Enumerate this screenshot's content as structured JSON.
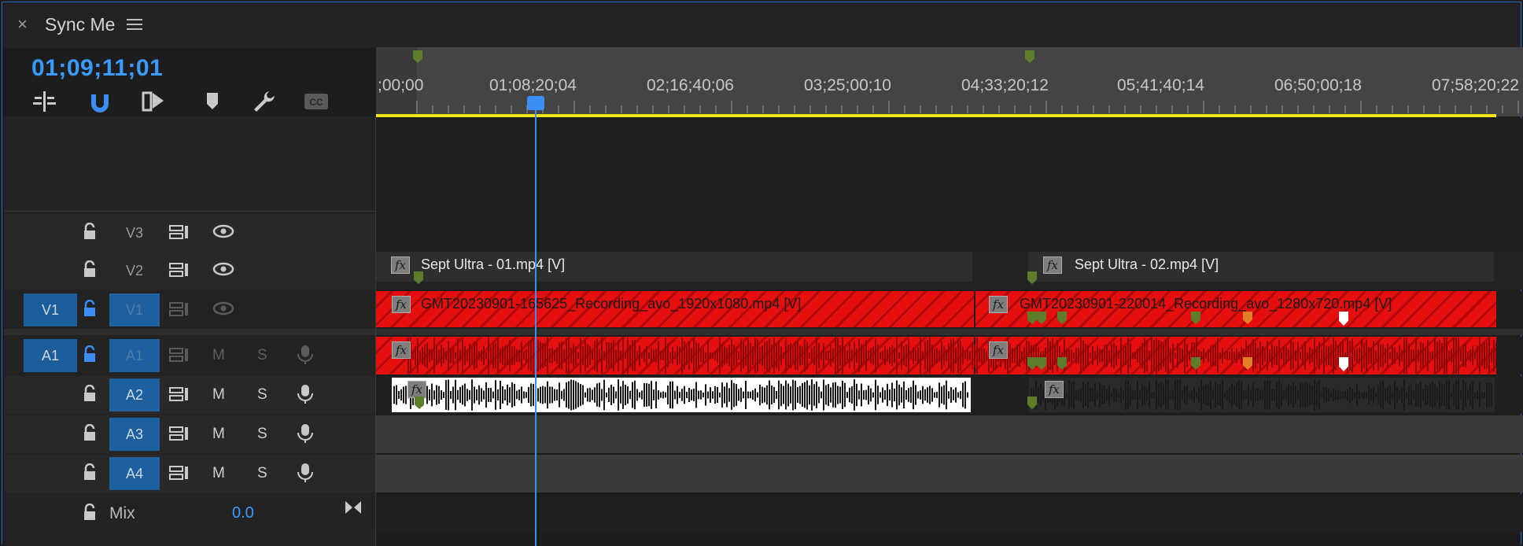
{
  "panel": {
    "title": "Sync Me",
    "close": "×"
  },
  "timecode": "01;09;11;01",
  "ruler": {
    "labels": [
      ";00;00",
      "01;08;20;04",
      "02;16;40;06",
      "03;25;00;10",
      "04;33;20;12",
      "05;41;40;14",
      "06;50;00;18",
      "07;58;20;22"
    ]
  },
  "toolbar": {
    "icons": [
      "insert-sequence-icon",
      "snap-icon",
      "linked-selection-icon",
      "add-marker-icon",
      "timeline-settings-icon",
      "captions-icon"
    ]
  },
  "tracks": {
    "v3": {
      "name": "V3"
    },
    "v2": {
      "name": "V2"
    },
    "v1": {
      "target": "V1",
      "name": "V1"
    },
    "a1": {
      "target": "A1",
      "name": "A1",
      "m": "M",
      "s": "S"
    },
    "a2": {
      "name": "A2",
      "m": "M",
      "s": "S"
    },
    "a3": {
      "name": "A3",
      "m": "M",
      "s": "S"
    },
    "a4": {
      "name": "A4",
      "m": "M",
      "s": "S"
    },
    "mix": {
      "name": "Mix",
      "value": "0.0"
    }
  },
  "clips": {
    "v2_1": "Sept Ultra - 01.mp4 [V]",
    "v2_2": "Sept Ultra - 02.mp4 [V]",
    "v1_1": "GMT20230901-165625_Recording_avo_1920x1080.mp4 [V]",
    "v1_2": "GMT20230901-220014_Recording_avo_1280x720.mp4 [V]",
    "fx": "fx"
  },
  "colors": {
    "accent": "#3a8ef6",
    "clip_red": "#e60f0f",
    "work_area": "#f2e21a",
    "target_blue": "#1c5d9c"
  }
}
